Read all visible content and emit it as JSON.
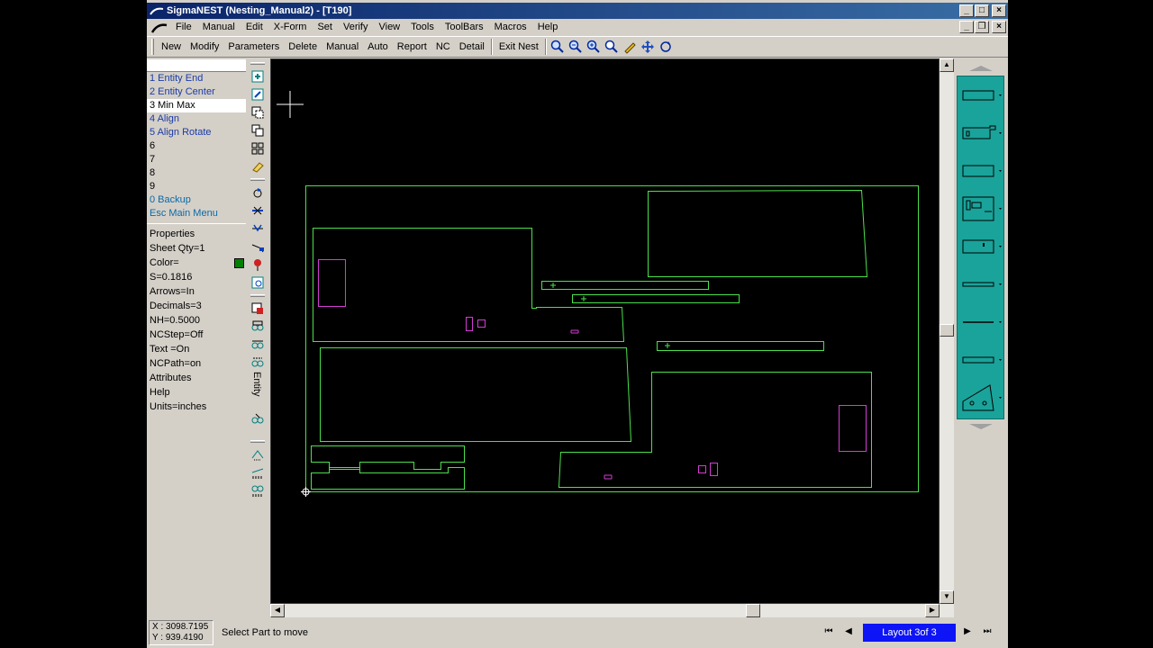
{
  "window": {
    "title": "SigmaNEST   (Nesting_Manual2) - [T190]"
  },
  "menu": [
    "File",
    "Manual",
    "Edit",
    "X-Form",
    "Set",
    "Verify",
    "View",
    "Tools",
    "ToolBars",
    "Macros",
    "Help"
  ],
  "toolbar": [
    "New",
    "Modify",
    "Parameters",
    "Delete",
    "Manual",
    "Auto",
    "Report",
    "NC",
    "Detail",
    "Exit Nest"
  ],
  "snap_menu": [
    {
      "label": "1 Entity End",
      "style": "blue"
    },
    {
      "label": "2 Entity Center",
      "style": "blue"
    },
    {
      "label": "3 Min Max",
      "style": "sel"
    },
    {
      "label": "4 Align",
      "style": "blue"
    },
    {
      "label": "5 Align Rotate",
      "style": "blue"
    },
    {
      "label": "6",
      "style": ""
    },
    {
      "label": "7",
      "style": ""
    },
    {
      "label": "8",
      "style": ""
    },
    {
      "label": "9",
      "style": ""
    },
    {
      "label": "0 Backup",
      "style": "teal"
    },
    {
      "label": "Esc Main Menu",
      "style": "teal"
    }
  ],
  "properties": {
    "header": "Properties",
    "sheet_qty": "Sheet Qty=1",
    "color_label": "Color=",
    "color": "#008000",
    "scale": "S=0.1816",
    "arrows": "Arrows=In",
    "decimals": "Decimals=3",
    "nh": "NH=0.5000",
    "ncstep": "NCStep=Off",
    "text": "Text  =On",
    "ncpath": "NCPath=on",
    "attributes": "Attributes",
    "help": "Help",
    "units": "Units=inches"
  },
  "vstrip_label": "Entity",
  "status": {
    "x": "X : 3098.7195",
    "y": "Y : 939.4190",
    "message": "Select Part to move",
    "layout": "Layout 3of 3"
  },
  "colors": {
    "part_outline": "#4ce04c",
    "hole": "#d23cd2",
    "sheet": "#4ce04c",
    "layout_highlight": "#0d14f5",
    "palette": "#1aa39a"
  }
}
